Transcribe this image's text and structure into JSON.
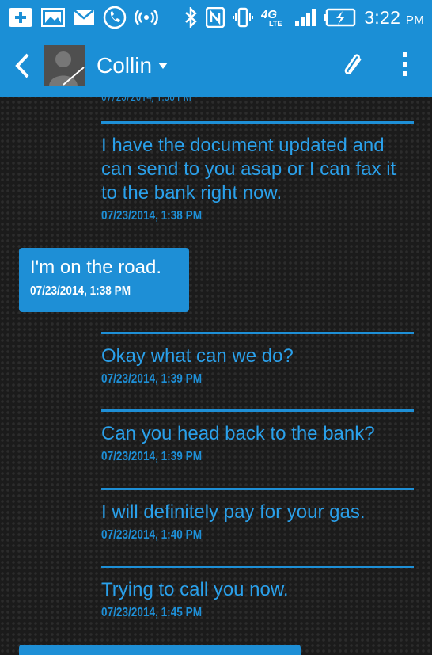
{
  "status_bar": {
    "time": "3:22",
    "ampm": "PM",
    "network": "4G LTE"
  },
  "header": {
    "contact_name": "Collin"
  },
  "conversation": {
    "cutoff_timestamp": "07/23/2014, 1:38 PM",
    "messages": [
      {
        "type": "sent",
        "text": "I have the document updated and can send to you asap or I can fax it to the bank right now.",
        "timestamp": "07/23/2014, 1:38 PM"
      },
      {
        "type": "received",
        "text": "I'm on the road.",
        "timestamp": "07/23/2014, 1:38 PM"
      },
      {
        "type": "sent",
        "text": "Okay what can we do?",
        "timestamp": "07/23/2014, 1:39 PM"
      },
      {
        "type": "sent",
        "text": "Can you head back to the bank?",
        "timestamp": "07/23/2014, 1:39 PM"
      },
      {
        "type": "sent",
        "text": "I will definitely pay for your gas.",
        "timestamp": "07/23/2014, 1:40 PM"
      },
      {
        "type": "sent",
        "text": "Trying to call you now.",
        "timestamp": "07/23/2014, 1:45 PM"
      }
    ]
  },
  "colors": {
    "accent": "#1b8fd6",
    "sent_text": "#2aa0ea",
    "background": "#1b1b1b"
  }
}
